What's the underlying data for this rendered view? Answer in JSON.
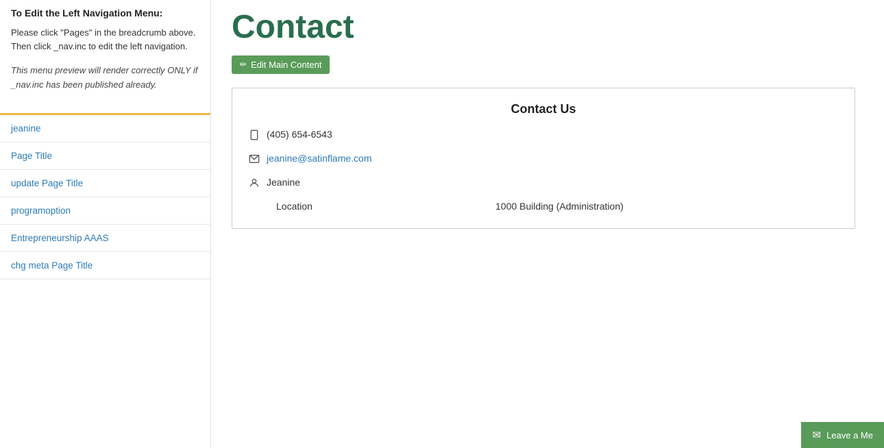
{
  "sidebar": {
    "heading": "To Edit the Left Navigation Menu:",
    "instruction1": "Please click \"Pages\" in the breadcrumb above. Then click _nav.inc to edit the left navigation.",
    "italic_note": "This menu preview will render correctly ONLY if _nav.inc has been published already.",
    "nav_items": [
      {
        "label": "jeanine",
        "href": "#"
      },
      {
        "label": "Page Title",
        "href": "#"
      },
      {
        "label": "update Page Title",
        "href": "#"
      },
      {
        "label": "programoption",
        "href": "#"
      },
      {
        "label": "Entrepreneurship AAAS",
        "href": "#"
      },
      {
        "label": "chg meta Page Title",
        "href": "#"
      }
    ]
  },
  "main": {
    "page_heading": "Contact",
    "edit_button_label": "Edit Main Content",
    "pencil_icon": "✏",
    "contact_box": {
      "heading": "Contact Us",
      "phone": "(405) 654-6543",
      "email": "jeanine@satinflame.com",
      "person": "Jeanine",
      "location_label": "Location",
      "location_value": "1000 Building (Administration)"
    }
  },
  "footer": {
    "leave_message_label": "Leave a Me",
    "mail_icon": "✉"
  },
  "colors": {
    "green_accent": "#2a6d4f",
    "button_green": "#5a9b5a",
    "link_blue": "#2e7bb5",
    "divider_yellow": "#e8b84b"
  }
}
